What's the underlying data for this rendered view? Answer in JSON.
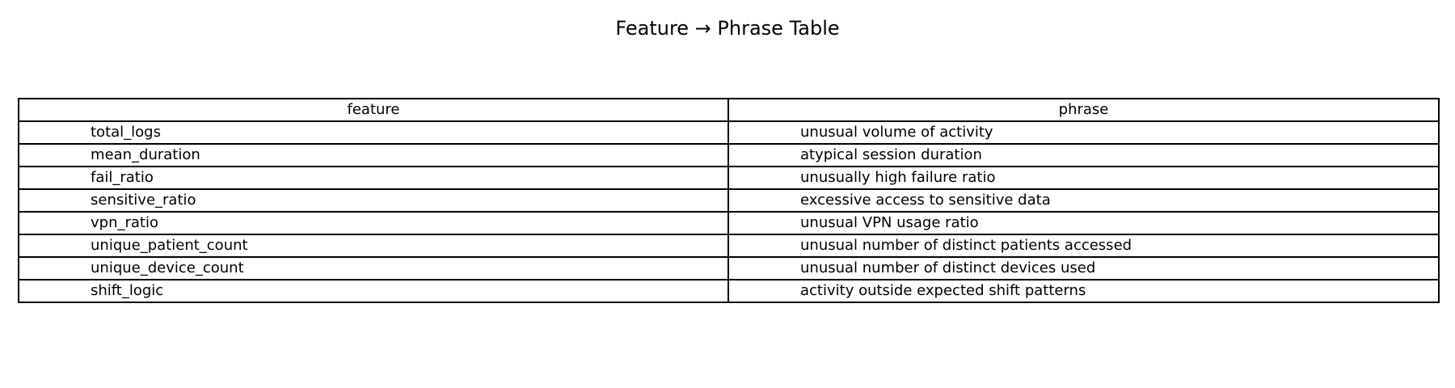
{
  "chart_data": {
    "type": "table",
    "title": "Feature → Phrase Table",
    "columns": [
      "feature",
      "phrase"
    ],
    "rows": [
      [
        "total_logs",
        "unusual volume of activity"
      ],
      [
        "mean_duration",
        "atypical session duration"
      ],
      [
        "fail_ratio",
        "unusually high failure ratio"
      ],
      [
        "sensitive_ratio",
        "excessive access to sensitive data"
      ],
      [
        "vpn_ratio",
        "unusual VPN usage ratio"
      ],
      [
        "unique_patient_count",
        "unusual number of distinct patients accessed"
      ],
      [
        "unique_device_count",
        "unusual number of distinct devices used"
      ],
      [
        "shift_logic",
        "activity outside expected shift patterns"
      ]
    ],
    "grid": true
  }
}
